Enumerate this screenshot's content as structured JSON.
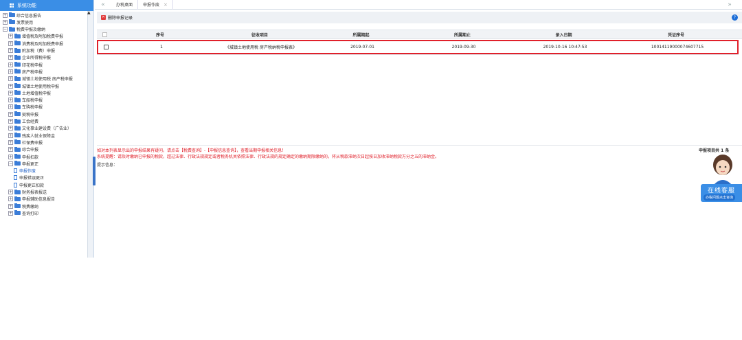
{
  "sidebar": {
    "title": "系统功能",
    "items": [
      {
        "label": "综合信息报告",
        "toggle": "+"
      },
      {
        "label": "发票使用",
        "toggle": "+"
      },
      {
        "label": "税费申报及缴纳",
        "toggle": "−"
      },
      {
        "label": "增值税及附加税费申报",
        "toggle": "+"
      },
      {
        "label": "消费税及附加税费申报",
        "toggle": "+"
      },
      {
        "label": "附加税（费）申报",
        "toggle": "+"
      },
      {
        "label": "企业所得税申报",
        "toggle": "+"
      },
      {
        "label": "印花税申报",
        "toggle": "+"
      },
      {
        "label": "房产税申报",
        "toggle": "+"
      },
      {
        "label": "城镇土地使用税 房产税申报",
        "toggle": "+"
      },
      {
        "label": "城镇土地使用税申报",
        "toggle": "+"
      },
      {
        "label": "土地增值税申报",
        "toggle": "+"
      },
      {
        "label": "车船税申报",
        "toggle": "+"
      },
      {
        "label": "车购税申报",
        "toggle": "+"
      },
      {
        "label": "契税申报",
        "toggle": "+"
      },
      {
        "label": "工会经费",
        "toggle": "+"
      },
      {
        "label": "文化事业建设费（广告业）",
        "toggle": "+"
      },
      {
        "label": "残疾人就业保障金",
        "toggle": "+"
      },
      {
        "label": "社保费申报",
        "toggle": "+"
      },
      {
        "label": "综合申报",
        "toggle": "+"
      },
      {
        "label": "申报扣款",
        "toggle": "+"
      },
      {
        "label": "申报更正",
        "toggle": "−"
      },
      {
        "label": "申报作废"
      },
      {
        "label": "申报错误更正"
      },
      {
        "label": "申报更正扣款"
      },
      {
        "label": "财务报表报送",
        "toggle": "+"
      },
      {
        "label": "申报辅助信息报告",
        "toggle": "+"
      },
      {
        "label": "税费缴纳",
        "toggle": "+"
      },
      {
        "label": "查询打印",
        "toggle": "+"
      }
    ]
  },
  "tabs": {
    "prev": "«",
    "next": "»",
    "items": [
      {
        "label": "办税桌面"
      },
      {
        "label": "申报作废",
        "close": "×"
      }
    ]
  },
  "toolbar": {
    "delete_label": "删除申报记录",
    "help": "?"
  },
  "table": {
    "columns": [
      "序号",
      "征收项目",
      "所属期起",
      "所属期止",
      "录入日期",
      "凭证序号"
    ],
    "rows": [
      {
        "seq": "1",
        "item": "《城镇土地使用税 房产税纳税申报表》",
        "start": "2019-07-01",
        "end": "2019-09-30",
        "entry": "2019-10-16 10:47:53",
        "voucher": "10014119000074607715"
      }
    ]
  },
  "messages": {
    "hint": "如对本列表显示出的申报结果有疑问，请点击【税费查询】-【申报信息查询】，查看当期申报相关信息！",
    "system": "系统提醒：请及时缴纳已申报的税款，超过法律、行政法规规定或者税务机关依照法律、行政法规的规定确定的缴纳期限缴纳的，将从税款滞纳次日起按日加收滞纳税款万分之五的滞纳金。",
    "tip_label": "提示信息：",
    "total": "申报项目共 1 条"
  },
  "service": {
    "title": "在线客服",
    "subtitle": "办税问题点击咨询"
  },
  "colors": {
    "accent": "#3a8ee6",
    "alert": "#e0202a"
  }
}
